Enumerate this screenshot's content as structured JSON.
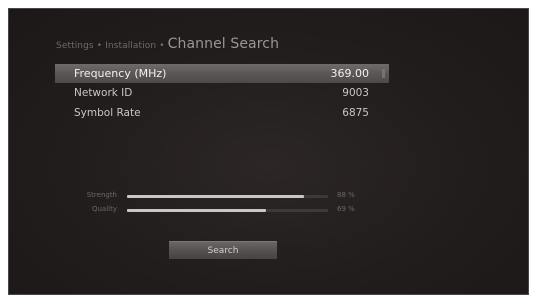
{
  "breadcrumb": {
    "items": [
      "Settings",
      "Installation"
    ],
    "separator": "•",
    "title": "Channel Search"
  },
  "params": [
    {
      "label": "Frequency (MHz)",
      "value": "369.00",
      "selected": true
    },
    {
      "label": "Network ID",
      "value": "9003",
      "selected": false
    },
    {
      "label": "Symbol Rate",
      "value": "6875",
      "selected": false
    }
  ],
  "signal": {
    "strength": {
      "label": "Strength",
      "value_text": "88 %",
      "level": 0.88
    },
    "quality": {
      "label": "Quality",
      "value_text": "69 %",
      "level": 0.69
    }
  },
  "search_button": {
    "label": "Search"
  },
  "colors": {
    "background": "#231e1e",
    "highlight": "#5b5757",
    "bar_fill": "#c9c6c6",
    "bar_track": "#3e3939"
  }
}
